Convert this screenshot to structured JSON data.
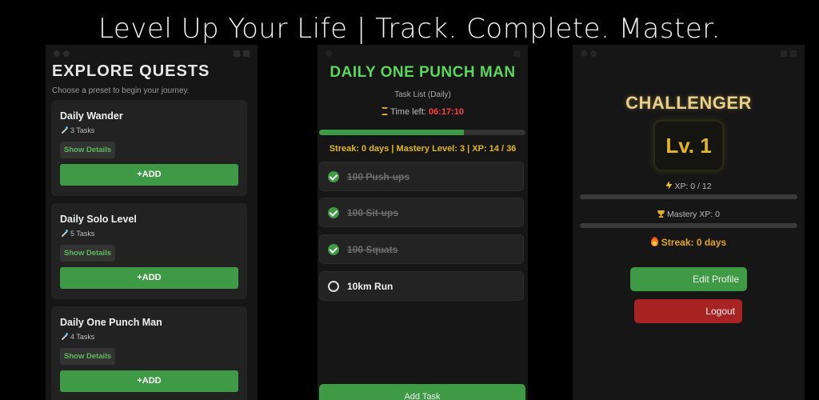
{
  "banner": "Level Up Your Life | Track. Complete. Master.",
  "explore": {
    "title": "EXPLORE QUESTS",
    "subtitle": "Choose a preset to begin your journey.",
    "cards": [
      {
        "title": "Daily Wander",
        "tasks": "3 Tasks",
        "show": "Show Details",
        "add": "+ADD"
      },
      {
        "title": "Daily Solo Level",
        "tasks": "5 Tasks",
        "show": "Show Details",
        "add": "+ADD"
      },
      {
        "title": "Daily One Punch Man",
        "tasks": "4 Tasks",
        "show": "Show Details",
        "add": "+ADD"
      }
    ]
  },
  "quest": {
    "title": "DAILY ONE PUNCH MAN",
    "subtitle": "Task List (Daily)",
    "time_label": "Time left:",
    "time_value": "06:17:10",
    "progress_fraction": 0.7,
    "streak_line": "Streak: 0 days | Mastery Level: 3 | XP: 14 / 36",
    "tasks": [
      {
        "label": "100 Push-ups",
        "done": true
      },
      {
        "label": "100 Sit-ups",
        "done": true
      },
      {
        "label": "100 Squats",
        "done": true
      },
      {
        "label": "10km Run",
        "done": false
      }
    ],
    "add_task": "Add Task"
  },
  "profile": {
    "rank": "CHALLENGER",
    "level": "Lv. 1",
    "xp": "XP: 0 / 12",
    "mastery_xp": "Mastery XP: 0",
    "streak": "Streak: 0 days",
    "edit": "Edit Profile",
    "logout": "Logout"
  },
  "colors": {
    "accent_green": "#3e9a44",
    "danger_red": "#a82424",
    "gold": "#e2b722"
  }
}
